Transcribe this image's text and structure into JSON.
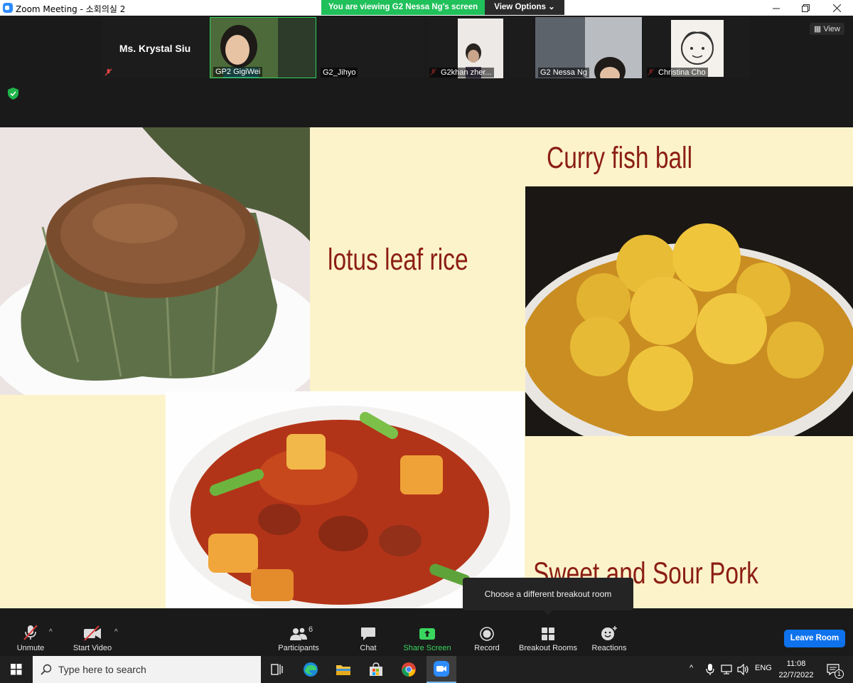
{
  "window": {
    "title": "Zoom Meeting - 소회의실 2",
    "banner": "You are viewing G2 Nessa Ng's screen",
    "view_options": "View Options"
  },
  "gallery": {
    "view_label": "View",
    "tiles": [
      {
        "name": "Ms. Krystal Siu"
      },
      {
        "name": "GP2 GigiWei"
      },
      {
        "name": "G2_Jihyo"
      },
      {
        "name": "G2khan zher..."
      },
      {
        "name": "G2 Nessa Ng"
      },
      {
        "name": "Christina Cho"
      }
    ]
  },
  "slide": {
    "dishes": [
      "lotus leaf rice",
      "Curry fish ball",
      "Sweet and Sour Pork"
    ]
  },
  "controls": {
    "unmute": "Unmute",
    "start_video": "Start Video",
    "participants": "Participants",
    "participants_count": "6",
    "chat": "Chat",
    "share_screen": "Share Screen",
    "record": "Record",
    "breakout_rooms": "Breakout Rooms",
    "reactions": "Reactions",
    "leave_room": "Leave Room",
    "tooltip": "Choose a different breakout room"
  },
  "taskbar": {
    "search_placeholder": "Type here to search",
    "language": "ENG",
    "time": "11:08",
    "date": "22/7/2022",
    "notification_count": "1"
  },
  "colors": {
    "banner_green": "#20c05a",
    "leave_blue": "#0e72ed",
    "slide_bg": "#fdf3cb",
    "title_red": "#8b1e14",
    "share_green": "#3ad55e"
  }
}
